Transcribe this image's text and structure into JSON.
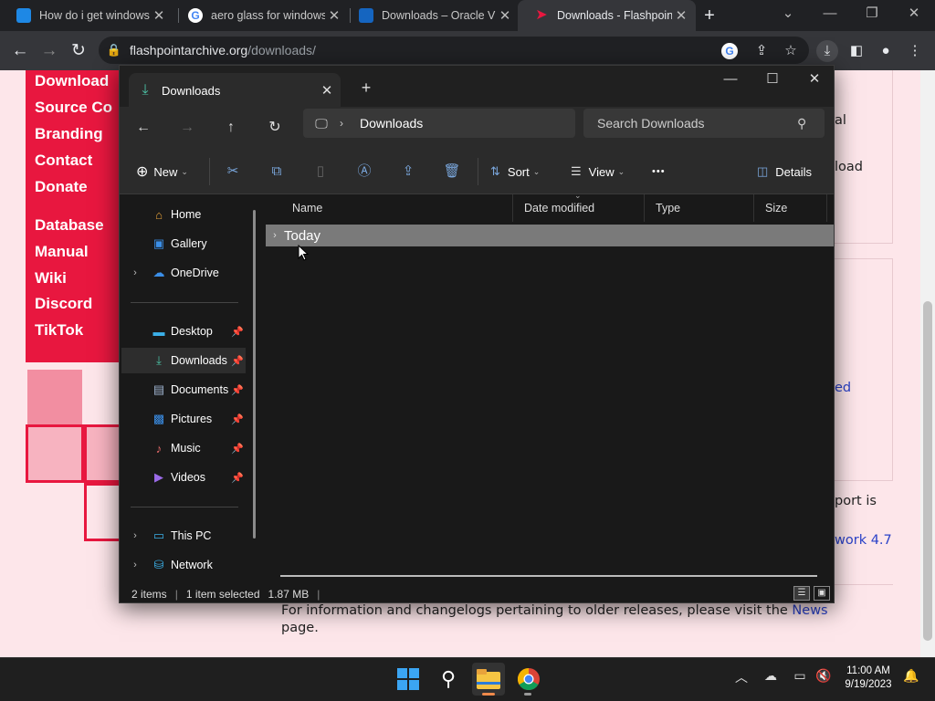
{
  "browser": {
    "tabs": [
      {
        "title": "How do i get windows",
        "close": "✕"
      },
      {
        "title": "aero glass for windows",
        "close": "✕"
      },
      {
        "title": "Downloads – Oracle VI",
        "close": "✕"
      },
      {
        "title": "Downloads - Flashpoint",
        "close": "✕"
      }
    ],
    "new_tab": "+",
    "url_host": "flashpointarchive.org",
    "url_path": "/downloads/"
  },
  "webpage": {
    "nav_links": [
      "Download",
      "Source Co",
      "Branding",
      "Contact",
      "Donate",
      "Database",
      "Manual",
      "Wiki",
      "Discord",
      "TikTok"
    ],
    "right_fragments": [
      "al",
      "load",
      "ed",
      "port is",
      "work 4.7"
    ],
    "footer_text": "For information and changelogs pertaining to older releases, please visit the",
    "footer_link": "News",
    "footer_tail": "page."
  },
  "explorer": {
    "tab_title": "Downloads",
    "tab_close": "✕",
    "new_tab": "+",
    "breadcrumb": "Downloads",
    "search_placeholder": "Search Downloads",
    "commands": {
      "new": "New",
      "sort": "Sort",
      "view": "View",
      "more": "•••",
      "details": "Details"
    },
    "nav": [
      {
        "label": "Home"
      },
      {
        "label": "Gallery"
      },
      {
        "label": "OneDrive"
      },
      {
        "label": "Desktop"
      },
      {
        "label": "Downloads"
      },
      {
        "label": "Documents"
      },
      {
        "label": "Pictures"
      },
      {
        "label": "Music"
      },
      {
        "label": "Videos"
      },
      {
        "label": "This PC"
      },
      {
        "label": "Network"
      }
    ],
    "columns": [
      "Name",
      "Date modified",
      "Type",
      "Size"
    ],
    "group_label": "Today",
    "status": {
      "items": "2 items",
      "selected": "1 item selected",
      "size": "1.87 MB"
    }
  },
  "taskbar": {
    "time": "11:00 AM",
    "date": "9/19/2023"
  }
}
